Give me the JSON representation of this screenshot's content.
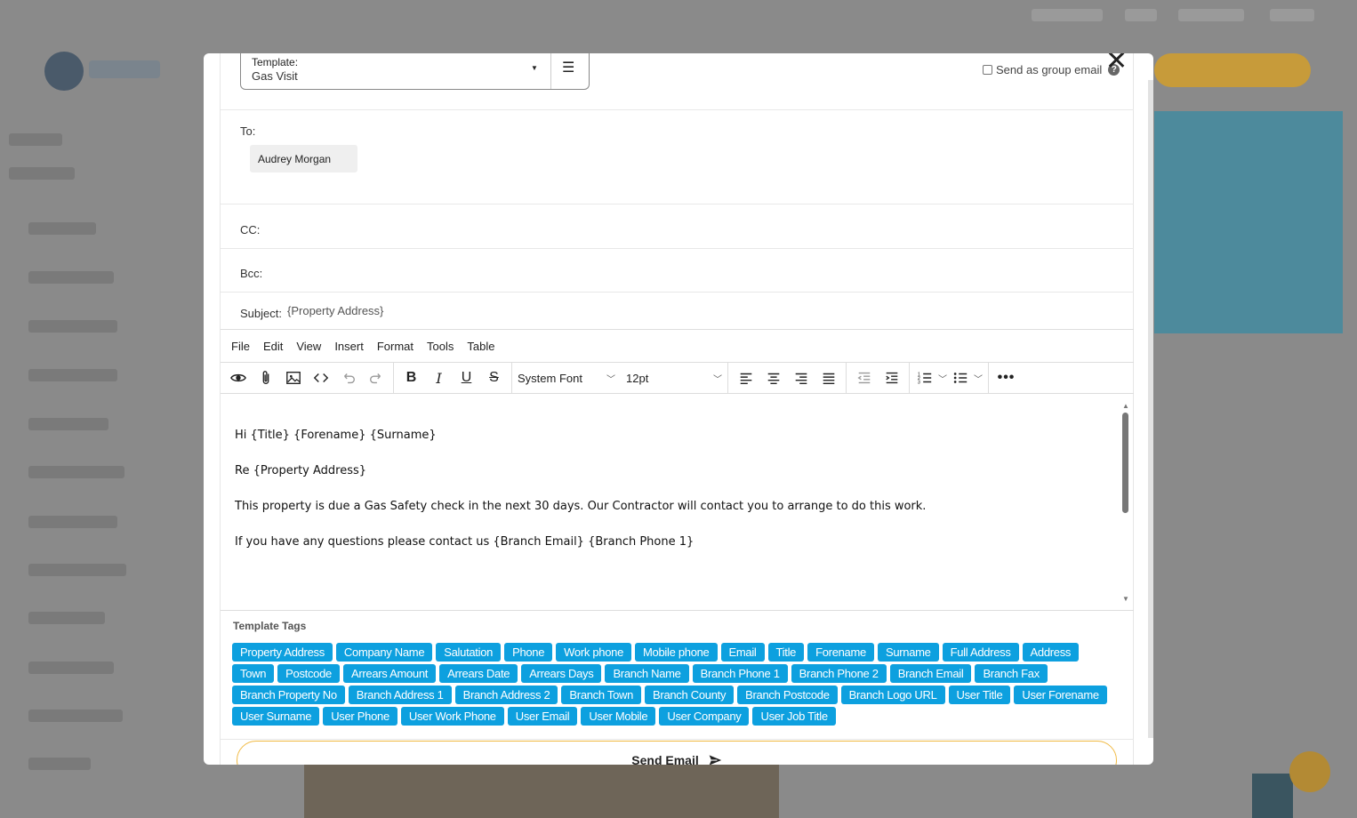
{
  "modal": {
    "template_label": "Template:",
    "template_value": "Gas Visit",
    "group_email_label": "Send as group email",
    "to_label": "To:",
    "recipient": "Audrey Morgan",
    "cc_label": "CC:",
    "bcc_label": "Bcc:",
    "subject_label": "Subject:",
    "subject_value": "{Property Address}"
  },
  "editor": {
    "menu": [
      "File",
      "Edit",
      "View",
      "Insert",
      "Format",
      "Tools",
      "Table"
    ],
    "font_family": "System Font",
    "font_size": "12pt",
    "body": [
      "Hi {Title} {Forename} {Surname}",
      "Re  {Property Address}",
      "This property is due a Gas Safety check in the next 30 days. Our Contractor will contact you to arrange to do this work.",
      "If you have any questions please contact us {Branch Email} {Branch Phone 1}"
    ]
  },
  "tags": {
    "title": "Template Tags",
    "items": [
      "Property Address",
      "Company Name",
      "Salutation",
      "Phone",
      "Work phone",
      "Mobile phone",
      "Email",
      "Title",
      "Forename",
      "Surname",
      "Full Address",
      "Address",
      "Town",
      "Postcode",
      "Arrears Amount",
      "Arrears Date",
      "Arrears Days",
      "Branch Name",
      "Branch Phone 1",
      "Branch Phone 2",
      "Branch Email",
      "Branch Fax",
      "Branch Property No",
      "Branch Address 1",
      "Branch Address 2",
      "Branch Town",
      "Branch County",
      "Branch Postcode",
      "Branch Logo URL",
      "User Title",
      "User Forename",
      "User Surname",
      "User Phone",
      "User Work Phone",
      "User Email",
      "User Mobile",
      "User Company",
      "User Job Title"
    ],
    "color": "#0da0df"
  },
  "send_button": "Send Email",
  "colors": {
    "send_border": "#f0b942",
    "overlay": "#7d7d7d"
  }
}
